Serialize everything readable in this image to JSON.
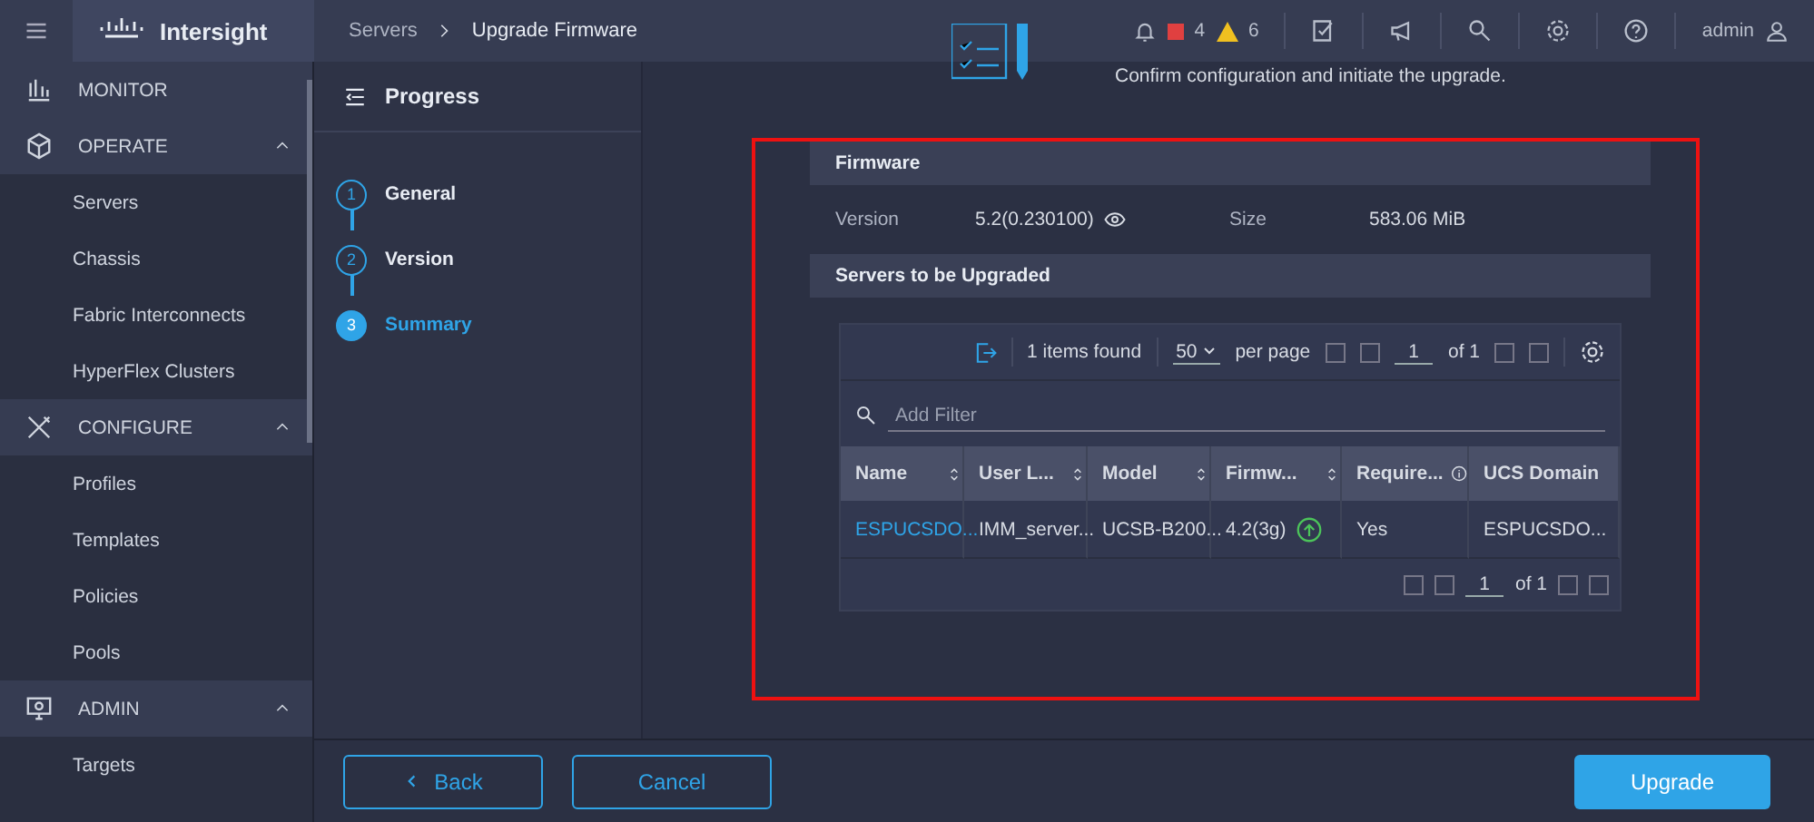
{
  "header": {
    "brand": "Intersight",
    "breadcrumb": [
      "Servers",
      "Upgrade Firmware"
    ],
    "alerts": {
      "critical": "4",
      "warning": "6"
    },
    "user": "admin"
  },
  "sidebar": {
    "sections": [
      {
        "label": "MONITOR"
      },
      {
        "label": "OPERATE",
        "expanded": true,
        "children": [
          {
            "label": "Servers"
          },
          {
            "label": "Chassis"
          },
          {
            "label": "Fabric Interconnects"
          },
          {
            "label": "HyperFlex Clusters"
          }
        ]
      },
      {
        "label": "CONFIGURE",
        "expanded": true,
        "children": [
          {
            "label": "Profiles"
          },
          {
            "label": "Templates"
          },
          {
            "label": "Policies"
          },
          {
            "label": "Pools"
          }
        ]
      },
      {
        "label": "ADMIN",
        "expanded": true,
        "children": [
          {
            "label": "Targets"
          }
        ]
      }
    ]
  },
  "progress": {
    "title": "Progress",
    "steps": [
      {
        "number": "1",
        "label": "General",
        "selected": false
      },
      {
        "number": "2",
        "label": "Version",
        "selected": false
      },
      {
        "number": "3",
        "label": "Summary",
        "selected": true
      }
    ]
  },
  "summary": {
    "description": "Confirm configuration and initiate the upgrade.",
    "firmware": {
      "heading": "Firmware",
      "fields": [
        {
          "label": "Version",
          "value": "5.2(0.230100)",
          "viewable": true
        },
        {
          "label": "Size",
          "value": "583.06 MiB",
          "viewable": false
        }
      ]
    },
    "servers_heading": "Servers to be Upgraded",
    "table": {
      "items_found": "1 items found",
      "per_page_value": "50",
      "per_page_label": "per page",
      "page": "1",
      "of_pages": "of 1",
      "filter_placeholder": "Add Filter",
      "columns": [
        {
          "label": "Name",
          "sortable": true,
          "info": false
        },
        {
          "label": "User L...",
          "sortable": true,
          "info": false
        },
        {
          "label": "Model",
          "sortable": true,
          "info": false
        },
        {
          "label": "Firmw...",
          "sortable": true,
          "info": false
        },
        {
          "label": "Require...",
          "sortable": false,
          "info": true
        },
        {
          "label": "UCS Domain",
          "sortable": false,
          "info": false
        }
      ],
      "rows": [
        {
          "cells": [
            "ESPUCSDO...",
            "IMM_server...",
            "UCSB-B200...",
            "4.2(3g)",
            "Yes",
            "ESPUCSDO..."
          ],
          "upgradable": true
        }
      ],
      "footer_page": "1",
      "footer_of": "of 1"
    }
  },
  "footer": {
    "back": "Back",
    "cancel": "Cancel",
    "upgrade": "Upgrade"
  }
}
